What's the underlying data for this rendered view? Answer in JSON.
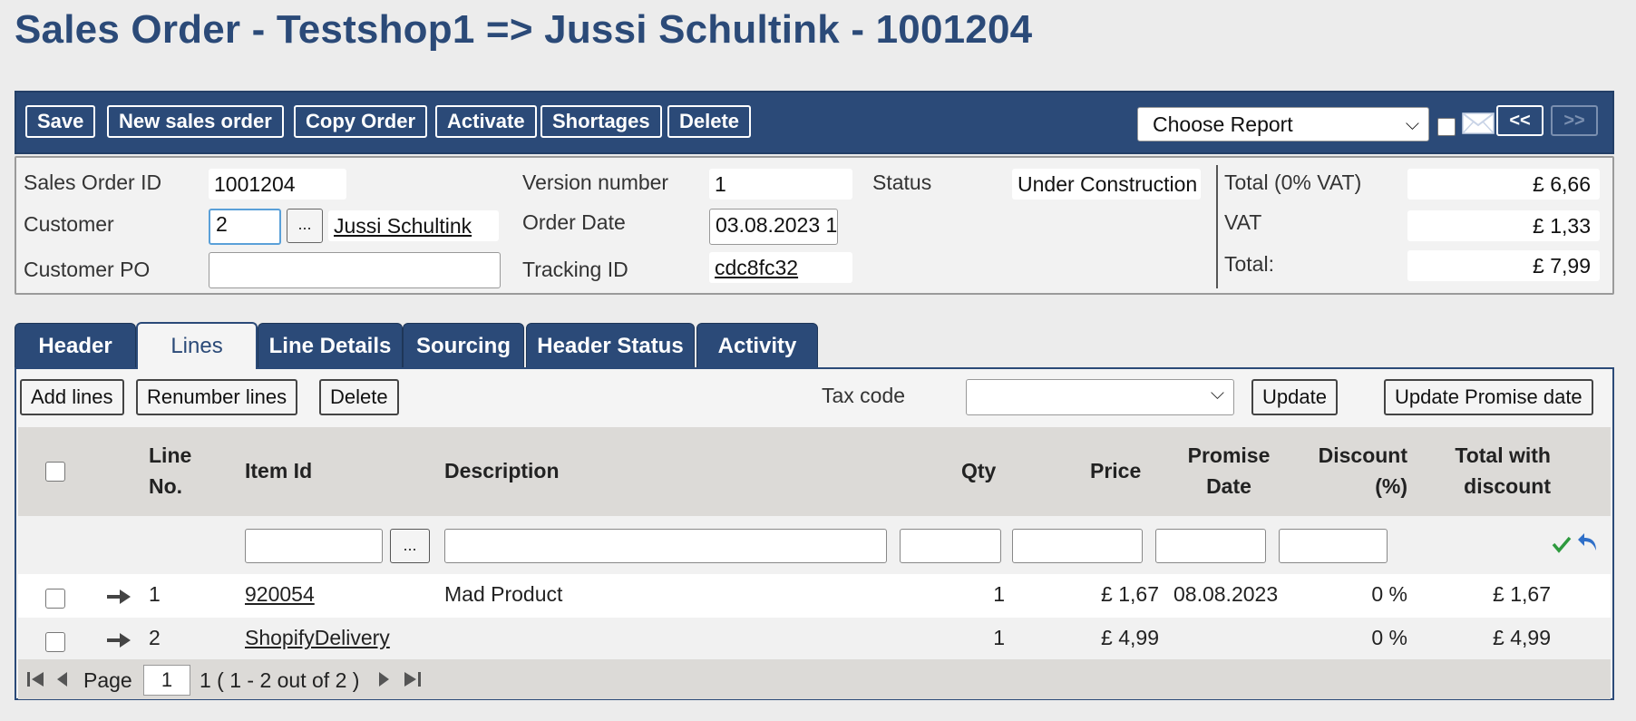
{
  "title": "Sales Order - Testshop1 => Jussi Schultink - 1001204",
  "toolbar": {
    "buttons": [
      "Save",
      "New sales order",
      "Copy Order",
      "Activate",
      "Shortages",
      "Delete"
    ],
    "report_select": "Choose Report",
    "prev": "<<",
    "next": ">>"
  },
  "info": {
    "sales_order_id_label": "Sales Order ID",
    "sales_order_id": "1001204",
    "customer_label": "Customer",
    "customer_id": "2",
    "customer_lookup": "...",
    "customer_name": "Jussi Schultink",
    "customer_po_label": "Customer PO",
    "customer_po": "",
    "version_label": "Version number",
    "version": "1",
    "order_date_label": "Order Date",
    "order_date": "03.08.2023 1",
    "tracking_label": "Tracking ID",
    "tracking_id": "cdc8fc32",
    "status_label": "Status",
    "status": "Under Construction",
    "total_ex_label": "Total (0% VAT)",
    "total_ex": "£ 6,66",
    "vat_label": "VAT",
    "vat": "£ 1,33",
    "total_label": "Total:",
    "total": "£ 7,99"
  },
  "tabs": [
    "Header",
    "Lines",
    "Line Details",
    "Sourcing",
    "Header Status",
    "Activity"
  ],
  "active_tab": "Lines",
  "grid": {
    "buttons": {
      "add_lines": "Add lines",
      "renumber": "Renumber lines",
      "delete": "Delete",
      "update": "Update",
      "update_promise": "Update Promise date"
    },
    "tax_code_label": "Tax code",
    "tax_code": "",
    "lookup": "...",
    "columns": {
      "line_no_1": "Line",
      "line_no_2": "No.",
      "item_id": "Item Id",
      "description": "Description",
      "qty": "Qty",
      "price": "Price",
      "promise_1": "Promise",
      "promise_2": "Date",
      "discount_1": "Discount",
      "discount_2": "(%)",
      "total_1": "Total with",
      "total_2": "discount"
    },
    "rows": [
      {
        "line": "1",
        "item": "920054",
        "description": "Mad Product",
        "qty": "1",
        "price": "£ 1,67",
        "promise": "08.08.2023",
        "discount": "0 %",
        "total": "£ 1,67"
      },
      {
        "line": "2",
        "item": "ShopifyDelivery",
        "description": "",
        "qty": "1",
        "price": "£ 4,99",
        "promise": "",
        "discount": "0 %",
        "total": "£ 4,99"
      }
    ],
    "pager": {
      "page_label": "Page",
      "page": "1",
      "summary": "1 ( 1 - 2 out of 2 )"
    }
  },
  "colors": {
    "brand": "#2b4a78",
    "accept": "#2e9a3e",
    "undo": "#2f6fc8"
  }
}
